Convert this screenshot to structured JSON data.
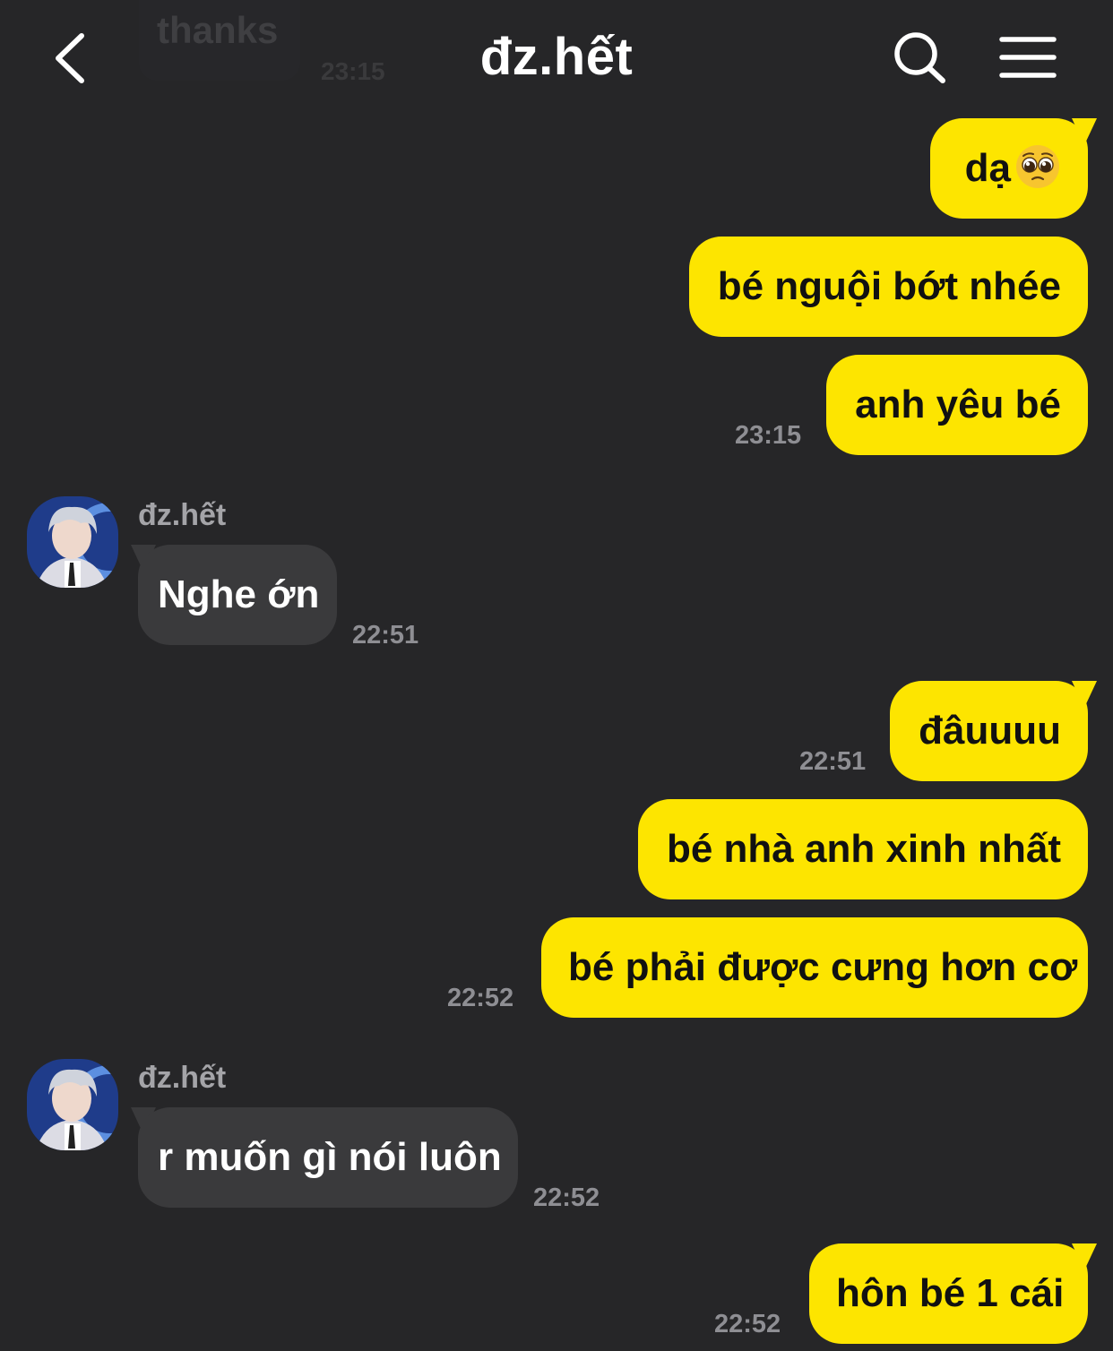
{
  "header": {
    "title": "đz.hết",
    "ghost_message": "thanks",
    "ghost_time": "23:15"
  },
  "contact": {
    "name": "đz.hết"
  },
  "messages": [
    {
      "from": "me",
      "text": "dạ",
      "emoji": "pleading-face-emoji"
    },
    {
      "from": "me",
      "text": "bé nguội bớt nhée"
    },
    {
      "from": "me",
      "text": "anh yêu bé",
      "time": "23:15"
    },
    {
      "from": "them",
      "sender": "đz.hết",
      "text": "Nghe ớn",
      "time": "22:51"
    },
    {
      "from": "me",
      "text": "đâuuuu",
      "time": "22:51"
    },
    {
      "from": "me",
      "text": "bé nhà anh xinh nhất"
    },
    {
      "from": "me",
      "text": "bé phải được cưng hơn cơ",
      "time": "22:52"
    },
    {
      "from": "them",
      "sender": "đz.hết",
      "text": "r muốn gì nói luôn",
      "time": "22:52"
    },
    {
      "from": "me",
      "text": "hôn bé 1 cái",
      "time": "22:52"
    }
  ],
  "colors": {
    "background": "#262628",
    "my_bubble": "#fde500",
    "their_bubble": "#3a3a3c",
    "timestamp": "#8e8e93"
  }
}
